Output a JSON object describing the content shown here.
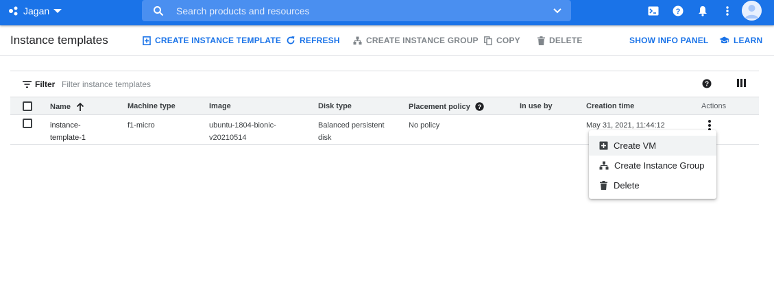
{
  "topbar": {
    "project_name": "Jagan",
    "search_placeholder": "Search products and resources",
    "icons": [
      "project-icon",
      "search-icon",
      "cloud-shell-icon",
      "help-icon",
      "notifications-icon",
      "more-vert-icon",
      "account-icon"
    ]
  },
  "toolbar": {
    "title": "Instance templates",
    "create_label": "CREATE INSTANCE TEMPLATE",
    "refresh_label": "REFRESH",
    "create_group_label": "CREATE INSTANCE GROUP",
    "copy_label": "COPY",
    "delete_label": "DELETE",
    "info_panel_label": "SHOW INFO PANEL",
    "learn_label": "LEARN"
  },
  "filter": {
    "label": "Filter",
    "placeholder": "Filter instance templates"
  },
  "table": {
    "columns": {
      "name": "Name",
      "machine_type": "Machine type",
      "image": "Image",
      "disk_type": "Disk type",
      "placement_policy": "Placement policy",
      "in_use_by": "In use by",
      "creation_time": "Creation time",
      "actions": "Actions"
    },
    "rows": [
      {
        "name_line1": "instance-",
        "name_line2": "template-1",
        "machine_type": "f1-micro",
        "image_line1": "ubuntu-1804-bionic-",
        "image_line2": "v20210514",
        "disk_line1": "Balanced persistent",
        "disk_line2": "disk",
        "placement_policy": "No policy",
        "in_use_by": "",
        "creation_time": "May 31, 2021, 11:44:12"
      }
    ]
  },
  "context_menu": {
    "items": [
      {
        "label": "Create VM",
        "icon": "add-box-icon"
      },
      {
        "label": "Create Instance Group",
        "icon": "instance-group-icon"
      },
      {
        "label": "Delete",
        "icon": "trash-icon"
      }
    ]
  },
  "colors": {
    "brand_blue": "#1a73e8",
    "header_bg": "#f1f3f4",
    "border": "#dadce0"
  }
}
